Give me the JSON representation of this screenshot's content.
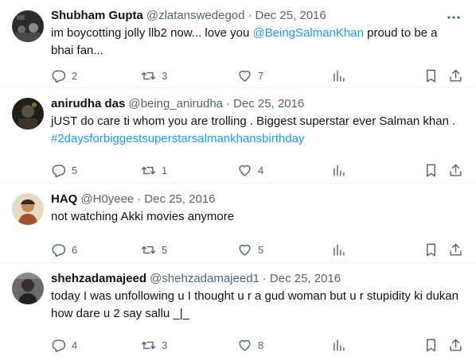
{
  "tweets": [
    {
      "name": "Shubham Gupta",
      "handle": "@zlatanswedegod",
      "date": "Dec 25, 2016",
      "text_1": "im boycotting jolly llb2 now... love you ",
      "mention": "@BeingSalmanKhan",
      "text_2": "  proud to be a bhai fan...",
      "replies": "2",
      "retweets": "3",
      "likes": "7"
    },
    {
      "name": "anirudha das",
      "handle": "@being_anirudha",
      "date": "Dec 25, 2016",
      "text_1": "jUST do care ti whom you are trolling . Biggest superstar ever Salman khan . ",
      "hashtag": "#2daysforbiggestsuperstarsalmankhansbirthday",
      "replies": "5",
      "retweets": "1",
      "likes": "4"
    },
    {
      "name": "HAQ",
      "handle": "@H0yeee",
      "date": "Dec 25, 2016",
      "text_1": "not watching Akki movies anymore",
      "replies": "6",
      "retweets": "5",
      "likes": "5"
    },
    {
      "name": "shehzadamajeed",
      "handle": "@shehzadamajeed1",
      "date": "Dec 25, 2016",
      "text_1": "today I was unfollowing u I thought u r a gud woman but u r stupidity ki dukan how dare u 2 say sallu _|_",
      "replies": "4",
      "retweets": "3",
      "likes": "8"
    }
  ],
  "separator": "·",
  "icons": {
    "more": "more-dots-icon",
    "reply": "reply-icon",
    "retweet": "retweet-icon",
    "like": "heart-icon",
    "views": "views-bar-chart-icon",
    "bookmark": "bookmark-icon",
    "share": "share-icon"
  },
  "colors": {
    "text": "#0f1419",
    "secondary": "#536471",
    "link": "#1d9bf0",
    "divider": "#eff3f4"
  }
}
